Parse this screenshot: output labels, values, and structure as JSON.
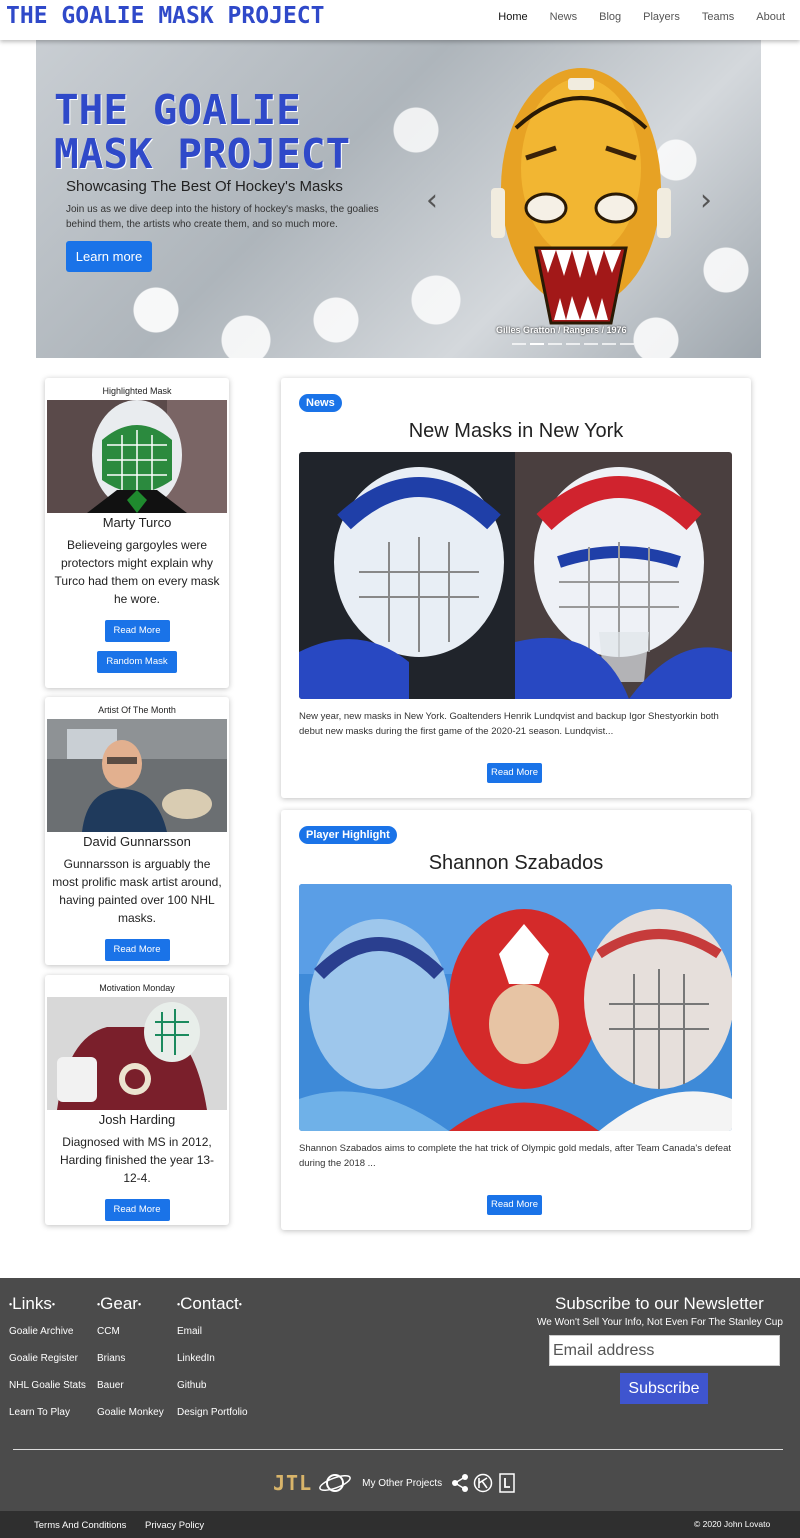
{
  "header": {
    "logo": "THE GOALIE MASK PROJECT",
    "nav": [
      "Home",
      "News",
      "Blog",
      "Players",
      "Teams",
      "About"
    ]
  },
  "hero": {
    "title": "THE GOALIE MASK PROJECT",
    "subtitle": "Showcasing The Best Of Hockey's Masks",
    "description": "Join us as we dive deep into the history of hockey's masks, the goalies behind them, the artists who create them, and so much more.",
    "button": "Learn more",
    "caption": "Gilles Gratton / Rangers / 1976",
    "prev_icon": "chevron-left-icon",
    "next_icon": "chevron-right-icon"
  },
  "side_cards": [
    {
      "label": "Highlighted Mask",
      "name": "Marty Turco",
      "description": "Believeing gargoyles were protectors might explain why Turco had them on every mask he wore.",
      "read_more": "Read More",
      "random": "Random Mask"
    },
    {
      "label": "Artist Of The Month",
      "name": "David Gunnarsson",
      "description": "Gunnarsson is arguably the most prolific mask artist around, having painted over 100 NHL masks.",
      "read_more": "Read More"
    },
    {
      "label": "Motivation Monday",
      "name": "Josh Harding",
      "description": "Diagnosed with MS in 2012, Harding finished the year 13-12-4.",
      "read_more": "Read More"
    }
  ],
  "main_cards": [
    {
      "badge": "News",
      "title": "New Masks in New York",
      "text": "New year, new masks in New York. Goaltenders Henrik Lundqvist and backup Igor Shestyorkin both debut new masks during the first game of the 2020-21 season. Lundqvist...",
      "read_more": "Read More"
    },
    {
      "badge": "Player Highlight",
      "title": "Shannon Szabados",
      "text": "Shannon Szabados aims to complete the hat trick of Olympic gold medals, after Team Canada's defeat during the 2018 ...",
      "read_more": "Read More"
    }
  ],
  "footer": {
    "links_heading": "Links",
    "links": [
      "Goalie Archive",
      "Goalie Register",
      "NHL Goalie Stats",
      "Learn To Play"
    ],
    "gear_heading": "Gear",
    "gear": [
      "CCM",
      "Brians",
      "Bauer",
      "Goalie Monkey"
    ],
    "contact_heading": "Contact",
    "contact": [
      "Email",
      "LinkedIn",
      "Github",
      "Design Portfolio"
    ],
    "newsletter_title": "Subscribe to our Newsletter",
    "newsletter_sub": "We Won't Sell Your Info, Not Even For The Stanley Cup",
    "email_placeholder": "Email address",
    "subscribe": "Subscribe",
    "jtl_logo": "JTL",
    "other_projects": "My Other Projects",
    "terms": "Terms And Conditions",
    "privacy": "Privacy Policy",
    "copyright": "© 2020 John Lovato"
  },
  "colors": {
    "brand_blue": "#2f49c9",
    "button_blue": "#1a73e8",
    "footer_bg": "#4b4b4b",
    "bottom_bar_bg": "#2f2f2f"
  }
}
